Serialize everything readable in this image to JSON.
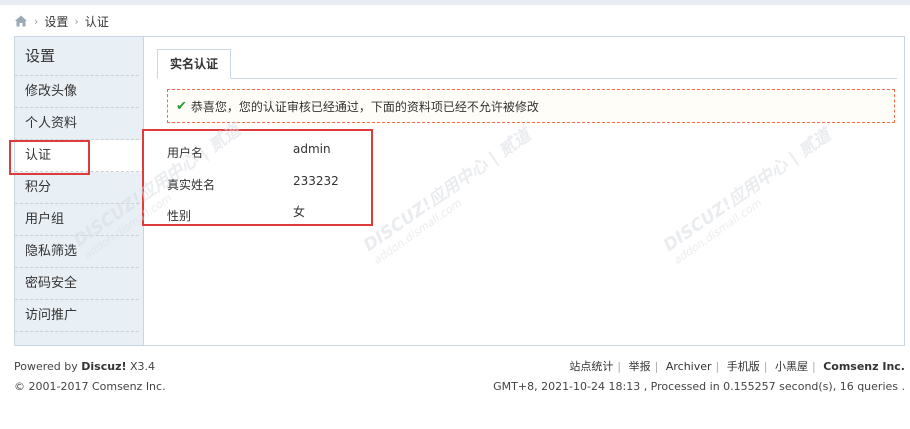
{
  "breadcrumb": {
    "items": [
      "设置",
      "认证"
    ],
    "separator": "›"
  },
  "sidebar": {
    "title": "设置",
    "items": [
      {
        "label": "修改头像"
      },
      {
        "label": "个人资料"
      },
      {
        "label": "认证"
      },
      {
        "label": "积分"
      },
      {
        "label": "用户组"
      },
      {
        "label": "隐私筛选"
      },
      {
        "label": "密码安全"
      },
      {
        "label": "访问推广"
      }
    ]
  },
  "tab": {
    "label": "实名认证"
  },
  "notice": {
    "text": "恭喜您，您的认证审核已经通过，下面的资料项已经不允许被修改",
    "check": "✔"
  },
  "fields": [
    {
      "label": "用户名",
      "value": "admin"
    },
    {
      "label": "真实姓名",
      "value": "233232"
    },
    {
      "label": "性别",
      "value": "女"
    }
  ],
  "watermark": {
    "main": "DISCUZ!应用中心 | 贰道",
    "sub": "addon.dismall.com"
  },
  "footer": {
    "powered_prefix": "Powered by ",
    "powered_name": "Discuz!",
    "version": " X3.4",
    "copyright": "© 2001-2017 Comsenz Inc.",
    "links": [
      "站点统计",
      "举报",
      "Archiver",
      "手机版",
      "小黑屋"
    ],
    "company": "Comsenz Inc.",
    "stats": "GMT+8, 2021-10-24 18:13 , Processed in 0.155257 second(s), 16 queries ."
  },
  "colors": {
    "highlight": "#e03b3b",
    "sidebar_bg": "#e8eff5",
    "border": "#c9d6e3",
    "check": "#2d9a2d"
  }
}
